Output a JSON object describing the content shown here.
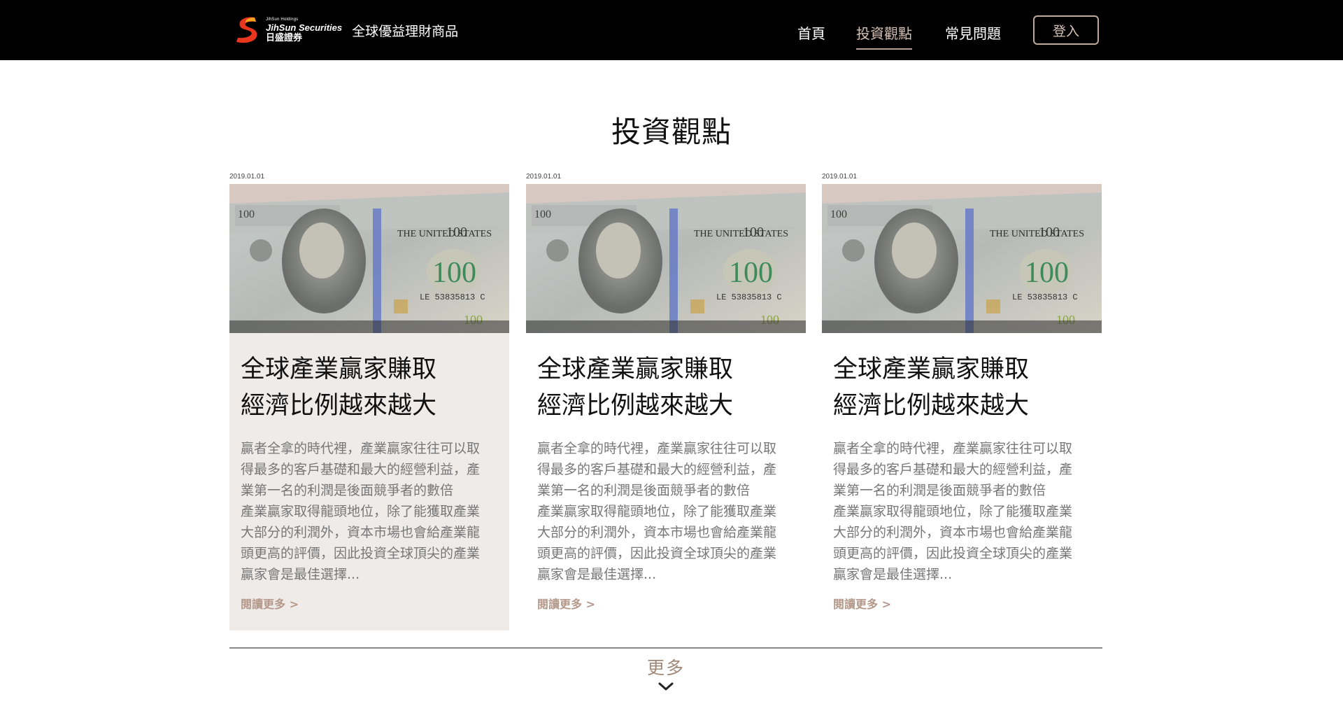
{
  "header": {
    "logo": {
      "holdings": "JihSun Holdings",
      "name_en": "JihSun Securities",
      "name_zh": "日盛證券",
      "icon": "jihsun-s-logo"
    },
    "tagline": "全球優益理財商品",
    "nav": [
      {
        "label": "首頁",
        "active": false
      },
      {
        "label": "投資觀點",
        "active": true
      },
      {
        "label": "常見問題",
        "active": false
      }
    ],
    "login_label": "登入"
  },
  "page_title": "投資觀點",
  "cards": [
    {
      "date": "2019.01.01",
      "image": "hundred-dollar-bills-photo",
      "title_lines": [
        "全球產業贏家賺取",
        "經濟比例越來越大"
      ],
      "excerpt_lines": [
        "贏者全拿的時代裡，產業贏家往往可以取",
        "得最多的客戶基礎和最大的經營利益，產",
        "業第一名的利潤是後面競爭者的數倍",
        "產業贏家取得龍頭地位，除了能獲取產業",
        "大部分的利潤外，資本市場也會給產業龍",
        "頭更高的評價，因此投資全球頂尖的產業",
        "贏家會是最佳選擇..."
      ],
      "read_more": "閱讀更多 >",
      "highlighted": true
    },
    {
      "date": "2019.01.01",
      "image": "hundred-dollar-bills-photo",
      "title_lines": [
        "全球產業贏家賺取",
        "經濟比例越來越大"
      ],
      "excerpt_lines": [
        "贏者全拿的時代裡，產業贏家往往可以取",
        "得最多的客戶基礎和最大的經營利益，產",
        "業第一名的利潤是後面競爭者的數倍",
        "產業贏家取得龍頭地位，除了能獲取產業",
        "大部分的利潤外，資本市場也會給產業龍",
        "頭更高的評價，因此投資全球頂尖的產業",
        "贏家會是最佳選擇..."
      ],
      "read_more": "閱讀更多 >",
      "highlighted": false
    },
    {
      "date": "2019.01.01",
      "image": "hundred-dollar-bills-photo",
      "title_lines": [
        "全球產業贏家賺取",
        "經濟比例越來越大"
      ],
      "excerpt_lines": [
        "贏者全拿的時代裡，產業贏家往往可以取",
        "得最多的客戶基礎和最大的經營利益，產",
        "業第一名的利潤是後面競爭者的數倍",
        "產業贏家取得龍頭地位，除了能獲取產業",
        "大部分的利潤外，資本市場也會給產業龍",
        "頭更高的評價，因此投資全球頂尖的產業",
        "贏家會是最佳選擇..."
      ],
      "read_more": "閱讀更多 >",
      "highlighted": false
    }
  ],
  "more_label": "更多",
  "more_icon": "chevron-down-icon",
  "colors": {
    "header_bg": "#000000",
    "accent": "#b4998a",
    "highlight_card_bg": "#efebe9",
    "excerpt_text": "#777777"
  }
}
